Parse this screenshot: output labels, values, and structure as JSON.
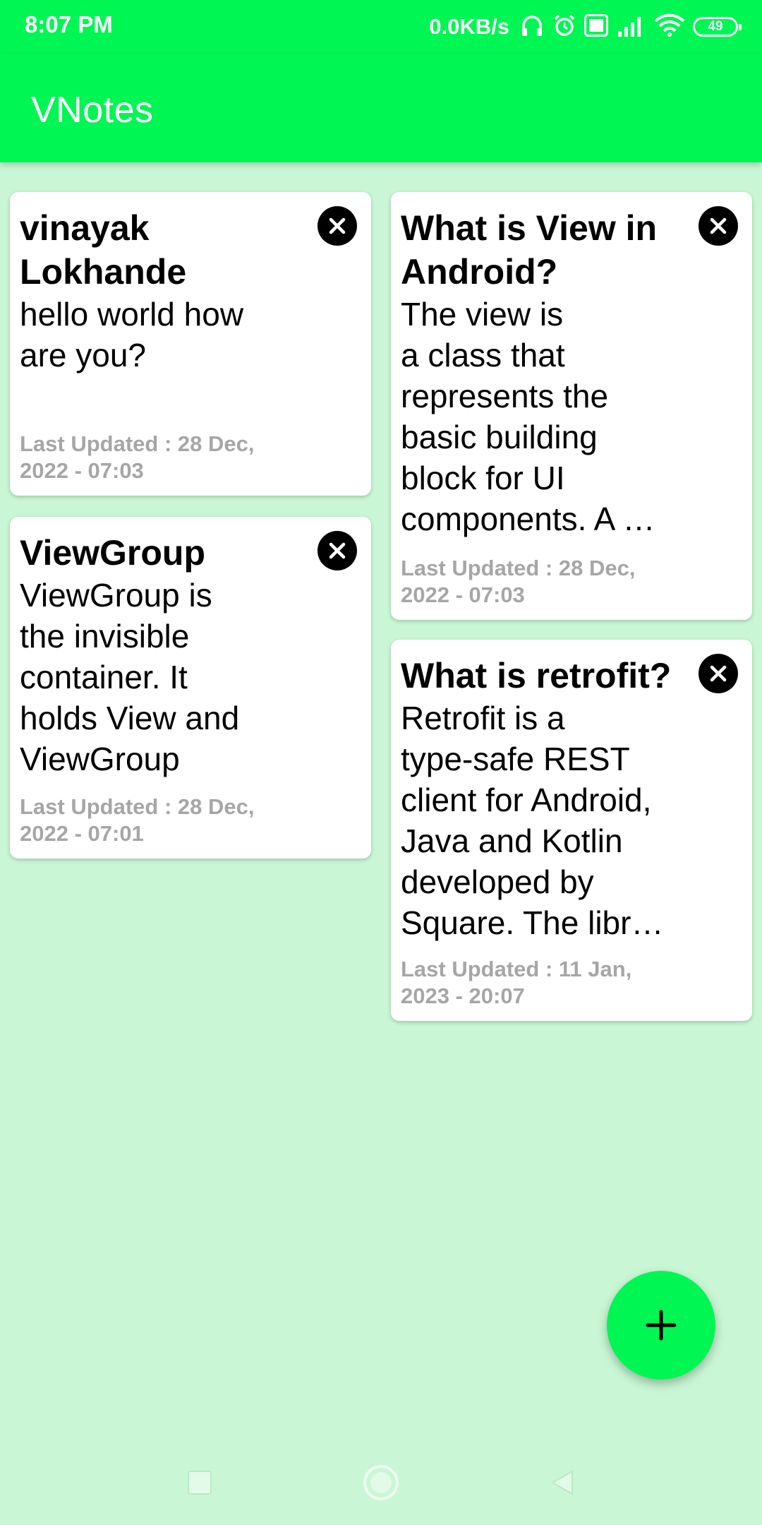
{
  "status_bar": {
    "time": "8:07 PM",
    "net_speed": "0.0KB/s",
    "battery": "49",
    "icons": [
      "headphones-icon",
      "alarm-icon",
      "volte-icon",
      "signal-icon",
      "wifi-icon",
      "battery-icon"
    ]
  },
  "app_bar": {
    "title": "VNotes"
  },
  "notes": [
    {
      "title": "vinayak\nLokhande",
      "body": "hello world how\nare you?",
      "updated": "Last Updated :  28 Dec,\n2022 - 07:03"
    },
    {
      "title": "What is View in\nAndroid?",
      "body": "The view is\na class that\nrepresents the\nbasic building\nblock for UI\ncomponents. A …",
      "updated": "Last Updated :  28 Dec,\n2022 - 07:03"
    },
    {
      "title": "ViewGroup",
      "body": "ViewGroup is\nthe invisible\ncontainer. It\nholds View and\nViewGroup",
      "updated": "Last Updated :  28 Dec,\n2022 - 07:01"
    },
    {
      "title": "What is retrofit?",
      "body": "Retrofit is a\ntype-safe REST\nclient for Android,\nJava and Kotlin\ndeveloped by\nSquare. The libr…",
      "updated": "Last Updated :  11 Jan,\n2023 - 20:07"
    }
  ],
  "fab": {
    "icon": "plus-icon"
  },
  "nav_bar": {
    "icons": [
      "recents-square-icon",
      "home-circle-icon",
      "back-triangle-icon"
    ]
  },
  "colors": {
    "primary": "#00f653",
    "background": "#c9f7d5",
    "card": "#ffffff",
    "date_text": "#a6a6a6"
  }
}
